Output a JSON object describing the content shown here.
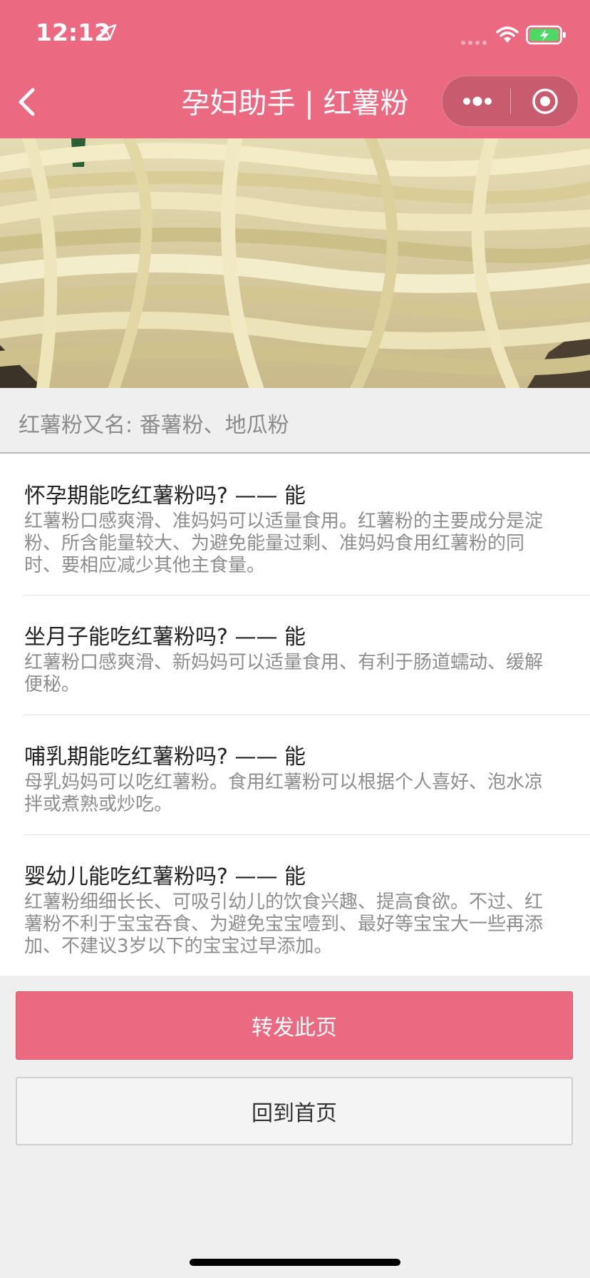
{
  "status_bar": {
    "time": "12:12",
    "icons": [
      "location-arrow-icon",
      "signal-dots-icon",
      "wifi-icon",
      "battery-charging-icon"
    ],
    "battery_color": "#4cd964"
  },
  "nav": {
    "back_icon": "chevron-left-icon",
    "title": "孕妇助手 | 红薯粉",
    "capsule_icons": [
      "more-icon",
      "target-icon"
    ],
    "color": "#eb6a82"
  },
  "hero": {
    "description": "sweet potato noodles"
  },
  "alias": {
    "text": "红薯粉又名: 番薯粉、地瓜粉"
  },
  "items": [
    {
      "question": "怀孕期能吃红薯粉吗? —— 能",
      "answer_lines": [
        "红薯粉口感爽滑、准妈妈可以适量食用。红薯粉的主要成分是淀",
        "粉、所含能量较大、为避免能量过剩、准妈妈食用红薯粉的同",
        "时、要相应减少其他主食量。"
      ]
    },
    {
      "question": "坐月子能吃红薯粉吗? —— 能",
      "answer_lines": [
        "红薯粉口感爽滑、新妈妈可以适量食用、有利于肠道蠕动、缓解",
        "便秘。"
      ]
    },
    {
      "question": "哺乳期能吃红薯粉吗? —— 能",
      "answer_lines": [
        "母乳妈妈可以吃红薯粉。食用红薯粉可以根据个人喜好、泡水凉",
        "拌或煮熟或炒吃。"
      ]
    },
    {
      "question": "婴幼儿能吃红薯粉吗? —— 能",
      "answer_lines": [
        "红薯粉细细长长、可吸引幼儿的饮食兴趣、提高食欲。不过、红",
        "薯粉不利于宝宝吞食、为避免宝宝噎到、最好等宝宝大一些再添",
        "加、不建议3岁以下的宝宝过早添加。"
      ]
    }
  ],
  "buttons": {
    "share": "转发此页",
    "home": "回到首页"
  }
}
